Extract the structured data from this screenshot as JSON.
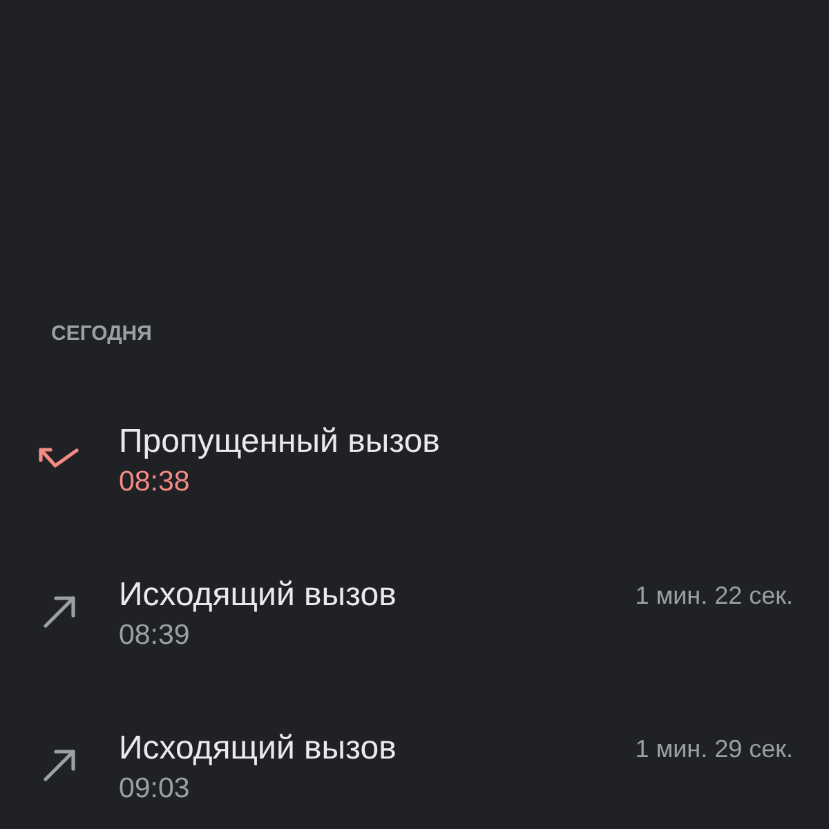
{
  "section": {
    "label": "СЕГОДНЯ"
  },
  "calls": [
    {
      "kind": "missed",
      "title": "Пропущенный вызов",
      "time": "08:38"
    },
    {
      "kind": "outgoing",
      "title": "Исходящий вызов",
      "time": "08:39",
      "duration": "1 мин. 22 сек."
    },
    {
      "kind": "outgoing",
      "title": "Исходящий вызов",
      "time": "09:03",
      "duration": "1 мин. 29 сек."
    }
  ]
}
